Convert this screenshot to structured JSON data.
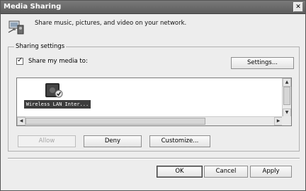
{
  "window": {
    "title": "Media Sharing"
  },
  "header": {
    "description": "Share music, pictures, and video on your network.",
    "icon": "media-sharing-icon"
  },
  "sharing_settings": {
    "group_label": "Sharing settings",
    "share_checkbox": {
      "label": "Share my media to:",
      "checked": true
    },
    "settings_button": "Settings...",
    "devices": [
      {
        "label": "Wireless LAN Inter...",
        "icon": "media-device-icon",
        "selected": true
      }
    ],
    "allow_button": "Allow",
    "deny_button": "Deny",
    "customize_button": "Customize..."
  },
  "footer": {
    "ok_button": "OK",
    "cancel_button": "Cancel",
    "apply_button": "Apply"
  }
}
